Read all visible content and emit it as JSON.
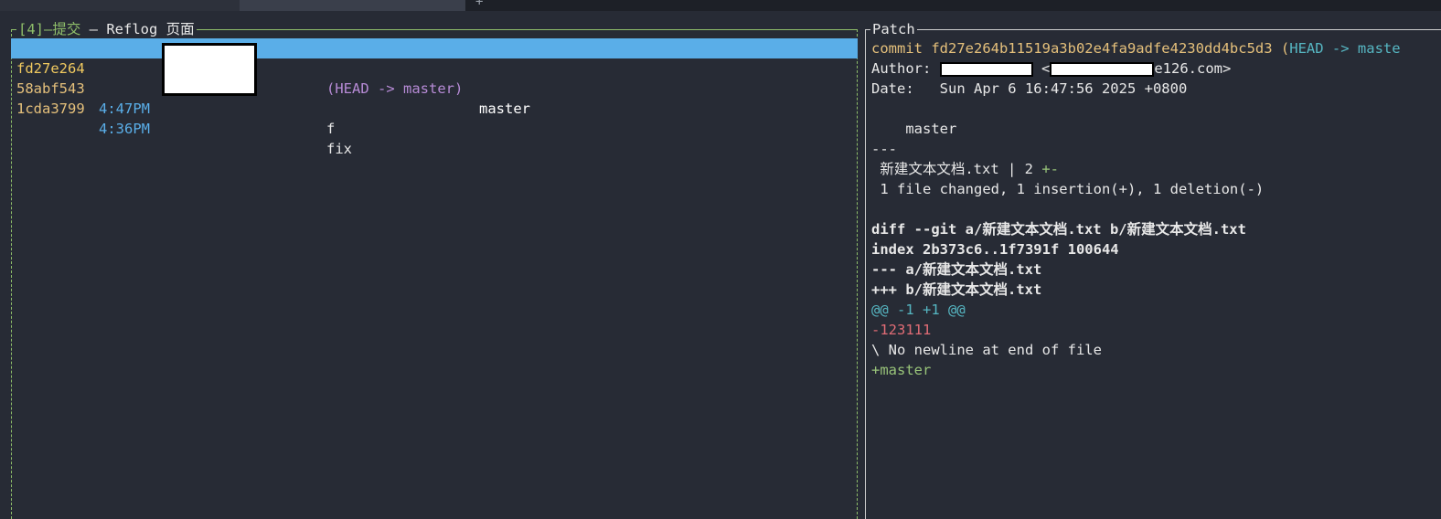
{
  "browser_tabs": {
    "plus_label": "+"
  },
  "commits_panel": {
    "title_tab": "[4]–提交",
    "title_rest": " – Reflog 页面",
    "rows": [
      {
        "hash": "fd27e264",
        "time": "",
        "ref": "(HEAD -> master)",
        "message": "master",
        "selected": true
      },
      {
        "hash": "58abf543",
        "time": "4:47PM",
        "ref": "",
        "message": "f",
        "selected": false
      },
      {
        "hash": "1cda3799",
        "time": "4:36PM",
        "ref": "",
        "message": "fix",
        "selected": false
      }
    ]
  },
  "patch_panel": {
    "title": "Patch",
    "commit_prefix": "commit fd27e264b11519a3b02e4fa9adfe4230dd4bc5d3 (",
    "commit_head": "HEAD -> maste",
    "author_label": "Author: ",
    "author_sep": " <",
    "author_suffix": "e126.com>",
    "date_line": "Date:   Sun Apr 6 16:47:56 2025 +0800",
    "message_line": "    master",
    "separator": "---",
    "stat_file": " 新建文本文档.txt | 2 ",
    "stat_marks": "+-",
    "stat_summary": " 1 file changed, 1 insertion(+), 1 deletion(-)",
    "diff_header": "diff --git a/新建文本文档.txt b/新建文本文档.txt",
    "index_line": "index 2b373c6..1f7391f 100644",
    "minus_file": "--- a/新建文本文档.txt",
    "plus_file": "+++ b/新建文本文档.txt",
    "hunk": "@@ -1 +1 @@",
    "removed_line": "-123111",
    "no_newline": "\\ No newline at end of file",
    "added_line": "+master"
  },
  "colors": {
    "background": "#272b35",
    "selection": "#5aaee8",
    "hash": "#e5c07b",
    "time": "#5aaee8",
    "frame_active": "#8fbf6a",
    "added": "#98c379",
    "removed": "#e06c75",
    "hunk": "#56b6c2"
  }
}
